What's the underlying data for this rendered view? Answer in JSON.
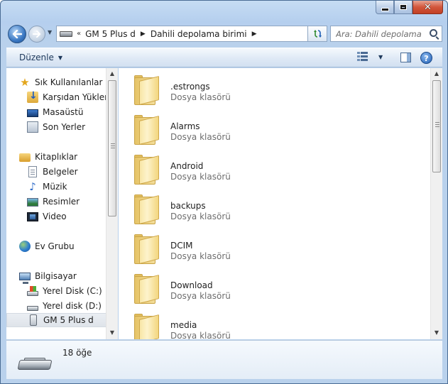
{
  "window": {
    "caption": {
      "minimize": "–",
      "maximize": "□",
      "close": "✕"
    }
  },
  "navigation": {
    "breadcrumb_overflow": "«",
    "path": [
      "GM 5 Plus d",
      "Dahili depolama birimi"
    ],
    "search_placeholder": "Ara: Dahili depolama ..."
  },
  "command_bar": {
    "organize_label": "Düzenle"
  },
  "nav_pane": {
    "favorites": {
      "label": "Sık Kullanılanlar",
      "items": [
        "Karşıdan Yüklem",
        "Masaüstü",
        "Son Yerler"
      ]
    },
    "libraries": {
      "label": "Kitaplıklar",
      "items": [
        "Belgeler",
        "Müzik",
        "Resimler",
        "Video"
      ]
    },
    "homegroup": {
      "label": "Ev Grubu"
    },
    "computer": {
      "label": "Bilgisayar",
      "items": [
        "Yerel Disk (C:)",
        "Yerel disk (D:)",
        "GM 5 Plus d"
      ],
      "selected_index": 2
    }
  },
  "files": [
    {
      "name": ".estrongs",
      "type": "Dosya klasörü"
    },
    {
      "name": "Alarms",
      "type": "Dosya klasörü"
    },
    {
      "name": "Android",
      "type": "Dosya klasörü"
    },
    {
      "name": "backups",
      "type": "Dosya klasörü"
    },
    {
      "name": "DCIM",
      "type": "Dosya klasörü"
    },
    {
      "name": "Download",
      "type": "Dosya klasörü"
    },
    {
      "name": "media",
      "type": "Dosya klasörü"
    }
  ],
  "details": {
    "item_count": "18 öğe"
  },
  "colors": {
    "frame": "#b9d1ec",
    "command_bar": "#dde8f5",
    "folder": "#f3d67f",
    "secondary_text": "#6d6d6d"
  }
}
